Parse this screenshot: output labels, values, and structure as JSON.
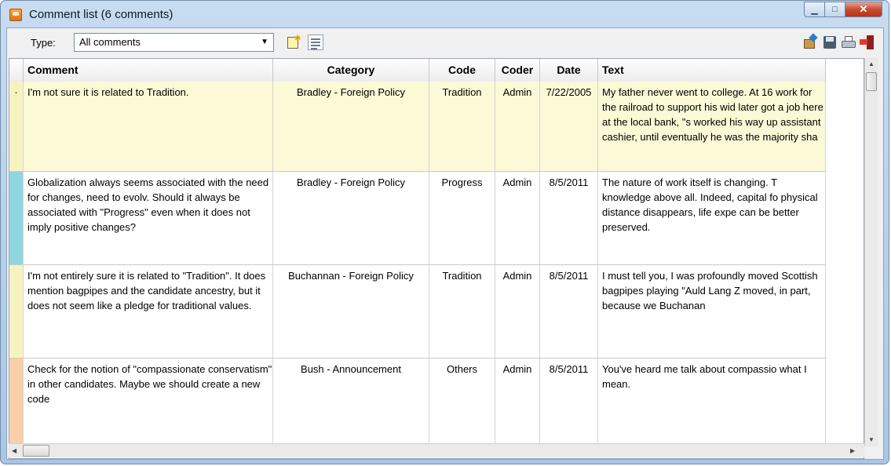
{
  "window": {
    "title": "Comment list (6 comments)"
  },
  "toolbar": {
    "type_label": "Type:",
    "type_value": "All comments",
    "icons": [
      "new-comment-icon",
      "list-view-icon",
      "export-icon",
      "save-icon",
      "print-icon",
      "exit-icon"
    ]
  },
  "table": {
    "columns": [
      "Comment",
      "Category",
      "Code",
      "Coder",
      "Date",
      "Text"
    ],
    "rows": [
      {
        "marker": "·",
        "color": "#f7f3c0",
        "comment": "I'm not sure it is related to Tradition.",
        "category": "Bradley - Foreign Policy",
        "code": "Tradition",
        "coder": "Admin",
        "date": "7/22/2005",
        "text": "My father never went to college. At 16 work for the railroad to support his wid later got a job here at the local bank, \"s worked his way up assistant cashier, until eventually he was the majority sha"
      },
      {
        "marker": "",
        "color": "#8fd6e0",
        "comment": "Globalization always seems associated with the need for changes, need to evolv. Should it always be associated with \"Progress\" even when it does not imply positive changes?",
        "category": "Bradley - Foreign Policy",
        "code": "Progress",
        "coder": "Admin",
        "date": "8/5/2011",
        "text": "The nature of work itself is changing. T knowledge above all. Indeed, capital fo physical distance disappears, life expe can be better preserved."
      },
      {
        "marker": "",
        "color": "#f7f3c0",
        "comment": "I'm not entirely sure it is related to \"Tradition\". It does mention bagpipes and the candidate ancestry, but it does not seem like a pledge for traditional values.",
        "category": "Buchannan - Foreign Policy",
        "code": "Tradition",
        "coder": "Admin",
        "date": "8/5/2011",
        "text": "I must tell you, I was profoundly moved Scottish bagpipes playing \"Auld Lang Z moved, in part, because we Buchanan"
      },
      {
        "marker": "",
        "color": "#f9cfa8",
        "comment": "Check for the notion of \"compassionate conservatism\" in other candidates. Maybe we should create a new code",
        "category": "Bush - Announcement",
        "code": "Others",
        "coder": "Admin",
        "date": "8/5/2011",
        "text": "You've heard me talk about compassio what I mean."
      }
    ]
  }
}
